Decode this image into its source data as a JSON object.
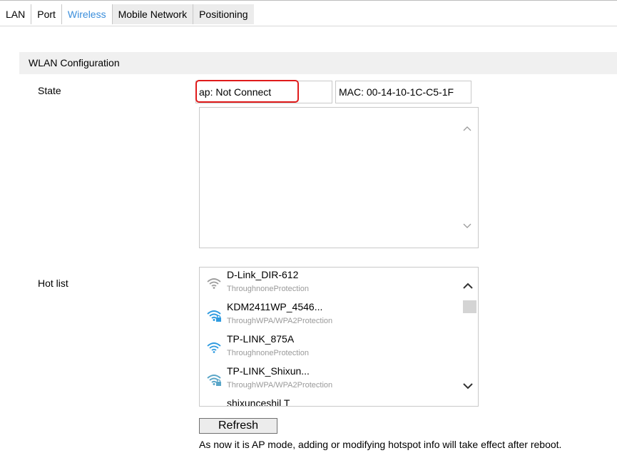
{
  "tabs": [
    {
      "label": "LAN",
      "active": false
    },
    {
      "label": "Port",
      "active": false
    },
    {
      "label": "Wireless",
      "active": true
    },
    {
      "label": "Mobile Network",
      "active": false
    },
    {
      "label": "Positioning",
      "active": false
    }
  ],
  "section": {
    "title": "WLAN Configuration"
  },
  "state": {
    "label": "State",
    "ap_value": "ap:  Not Connect",
    "mac_value": "MAC:  00-14-10-1C-C5-1F",
    "log_text": ""
  },
  "hotlist": {
    "label": "Hot list",
    "items": [
      {
        "ssid": "D-Link_DIR-612",
        "security": "ThroughnoneProtection",
        "icon": "wifi-icon",
        "color": "#9e9e9e"
      },
      {
        "ssid": "KDM2411WP_4546...",
        "security": "ThroughWPA/WPA2Protection",
        "icon": "wifi-lock-icon",
        "color": "#2f9be0"
      },
      {
        "ssid": "TP-LINK_875A",
        "security": "ThroughnoneProtection",
        "icon": "wifi-icon",
        "color": "#2f9be0"
      },
      {
        "ssid": "TP-LINK_Shixun...",
        "security": "ThroughWPA/WPA2Protection",
        "icon": "wifi-lock-icon",
        "color": "#5aa6c8"
      },
      {
        "ssid": "shixunceshil T",
        "security": "",
        "icon": "wifi-icon",
        "color": "#9e9e9e"
      }
    ]
  },
  "refresh_label": "Refresh",
  "note": "As now it is AP mode, adding or modifying hotspot info will take effect after reboot.",
  "colors": {
    "active_tab": "#3b8edb",
    "highlight": "#e01b1b"
  }
}
